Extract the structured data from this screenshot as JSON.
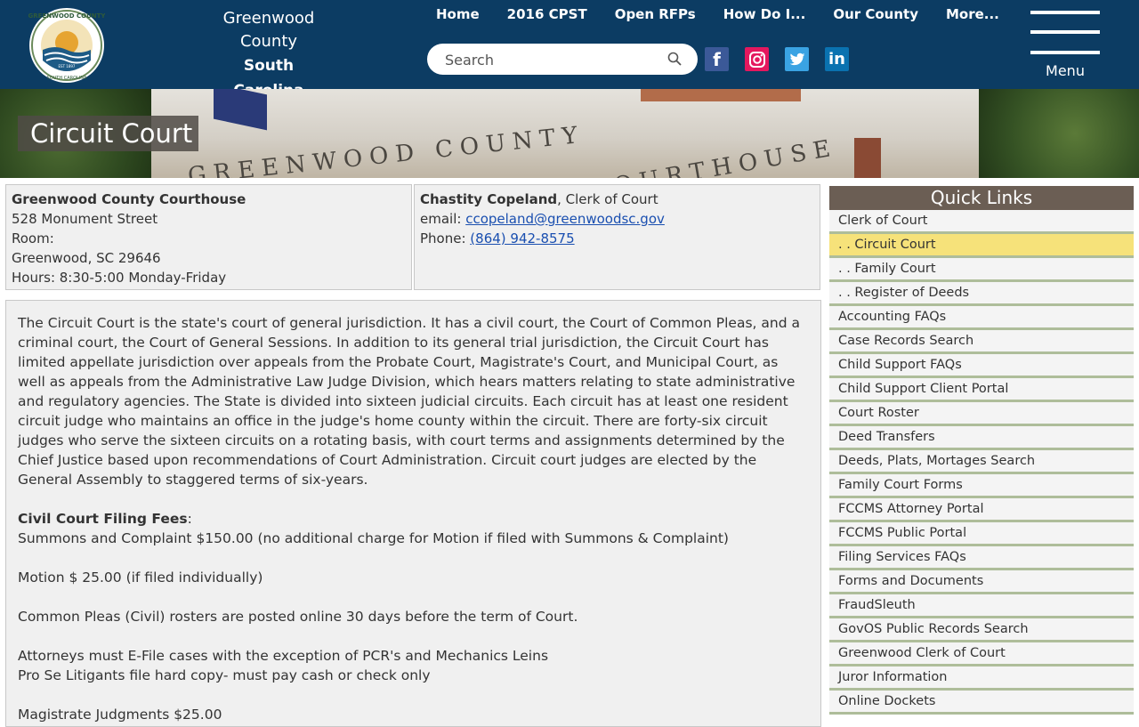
{
  "header": {
    "county_line1": "Greenwood",
    "county_line2": "County",
    "state": "South Carolina",
    "seal_text_top": "GREENWOOD COUNTY",
    "seal_text_bottom": "SOUTH CAROLINA",
    "seal_est": "EST 1897",
    "nav": [
      "Home",
      "2016 CPST",
      "Open RFPs",
      "How Do I...",
      "Our County",
      "More..."
    ],
    "search_placeholder": "Search",
    "social": [
      "facebook-icon",
      "instagram-icon",
      "twitter-icon",
      "linkedin-icon"
    ],
    "menu_label": "Menu"
  },
  "banner": {
    "engraving_line1": "GREENWOOD  COUNTY",
    "engraving_line2": "COURTHOUSE",
    "page_title": "Circuit Court"
  },
  "location_box": {
    "name": "Greenwood County Courthouse",
    "street": "528 Monument Street",
    "room": "Room:",
    "city": "Greenwood, SC 29646",
    "hours": "Hours: 8:30-5:00 Monday-Friday"
  },
  "clerk_box": {
    "name": "Chastity Copeland",
    "title": ", Clerk of Court",
    "email_label": "email: ",
    "email": "ccopeland@greenwoodsc.gov",
    "phone_label": "Phone: ",
    "phone": "(864) 942-8575"
  },
  "content": {
    "intro": "The Circuit Court is the state's court of general jurisdiction. It has a civil court, the Court of Common Pleas, and a criminal court, the Court of General Sessions. In addition to its general trial jurisdiction, the Circuit Court has limited appellate jurisdiction over appeals from the Probate Court, Magistrate's Court, and Municipal Court, as well as appeals from the Administrative Law Judge Division, which hears matters relating to state administrative and regulatory agencies. The State is divided into sixteen judicial circuits. Each circuit has at least one resident circuit judge who maintains an office in the judge's home county within the circuit. There are forty-six circuit judges who serve the sixteen circuits on a rotating basis, with court terms and assignments determined by the Chief Justice based upon recommendations of Court Administration. Circuit court judges are elected by the General Assembly to staggered terms of six-years.",
    "fees_heading": "Civil Court Filing Fees",
    "fees_colon": ":",
    "fee1": "Summons and Complaint $150.00 (no additional charge for Motion if filed with Summons & Complaint)",
    "fee2": "Motion $ 25.00 (if filed individually)",
    "rosters": "Common Pleas (Civil) rosters are posted online 30 days before the term of Court.",
    "efile": "Attorneys must E-File cases with the exception of PCR's and Mechanics Leins",
    "prose": "Pro Se Litigants file hard copy- must pay cash or check only",
    "magistrate": "Magistrate Judgments $25.00"
  },
  "quick_links": {
    "title": "Quick Links",
    "items": [
      "Clerk of Court",
      ". . Circuit Court",
      ". . Family Court",
      ". . Register of Deeds",
      "Accounting FAQs",
      "Case Records Search",
      "Child Support FAQs",
      "Child Support Client Portal",
      "Court Roster",
      "Deed Transfers",
      "Deeds, Plats, Mortages Search",
      "Family Court Forms",
      "FCCMS Attorney Portal",
      "FCCMS Public Portal",
      "Filing Services FAQs",
      "Forms and Documents",
      "FraudSleuth",
      "GovOS Public Records Search",
      "Greenwood Clerk of Court",
      "Juror Information",
      "Online Dockets"
    ],
    "active_index": 1,
    "active_color": "#f6e27a"
  },
  "colors": {
    "header_bg": "#0c3c63",
    "link": "#1a4fb0",
    "quick_links_header": "#6b5e54",
    "divider": "#aebd9a"
  }
}
